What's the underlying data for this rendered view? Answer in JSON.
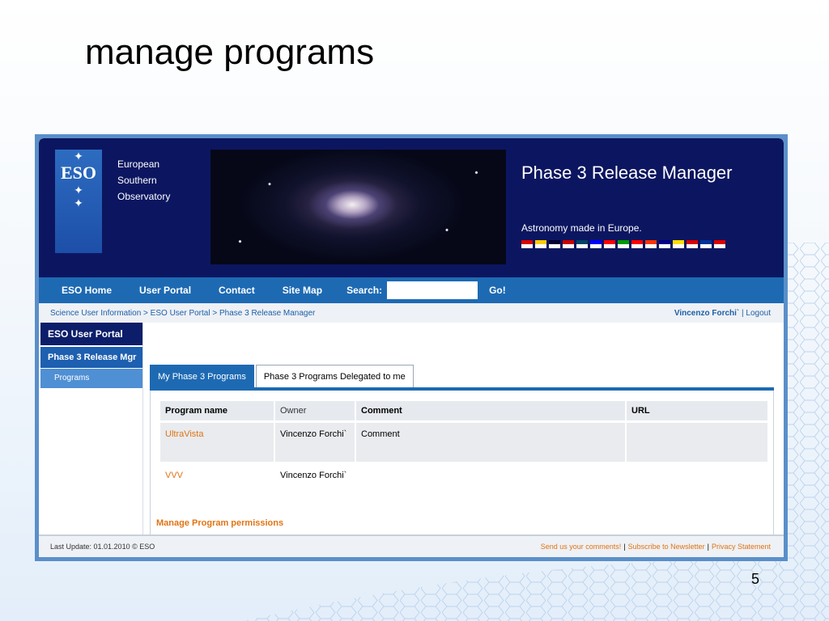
{
  "slide": {
    "title": "manage programs",
    "number": "5"
  },
  "header": {
    "org_lines": [
      "European",
      "Southern",
      "Observatory"
    ],
    "logo_text": "ESO",
    "app_title": "Phase 3 Release Manager",
    "tagline": "Astronomy made in Europe."
  },
  "flags": [
    "#d00",
    "#fc0",
    "#003",
    "#c00",
    "#046",
    "#00f",
    "#f00",
    "#090",
    "#f00",
    "#f30",
    "#008",
    "#fd0",
    "#d00",
    "#039",
    "#d00"
  ],
  "nav": {
    "items": [
      "ESO Home",
      "User Portal",
      "Contact",
      "Site Map"
    ],
    "search_label": "Search:",
    "search_value": "",
    "go_label": "Go!"
  },
  "breadcrumb": {
    "path": "Science User Information > ESO User Portal > Phase 3 Release Manager",
    "user": "Vincenzo Forchi`",
    "logout": "| Logout"
  },
  "sidebar": {
    "portal": "ESO User Portal",
    "section": "Phase 3 Release Mgr",
    "item": "Programs"
  },
  "tabs": [
    {
      "label": "My Phase 3 Programs",
      "active": true
    },
    {
      "label": "Phase 3 Programs Delegated to me",
      "active": false
    }
  ],
  "table": {
    "columns": [
      "Program name",
      "Owner",
      "Comment",
      "URL"
    ],
    "rows": [
      {
        "name": "UltraVista",
        "owner": "Vincenzo Forchi`",
        "comment": "Comment",
        "url": ""
      },
      {
        "name": "VVV",
        "owner": "Vincenzo Forchi`",
        "comment": "",
        "url": ""
      }
    ]
  },
  "manage_link": "Manage Program permissions",
  "footer": {
    "last_update": "Last Update: 01.01.2010 © ESO",
    "links": [
      "Send us your comments!",
      "Subscribe to Newsletter",
      "Privacy Statement"
    ]
  }
}
